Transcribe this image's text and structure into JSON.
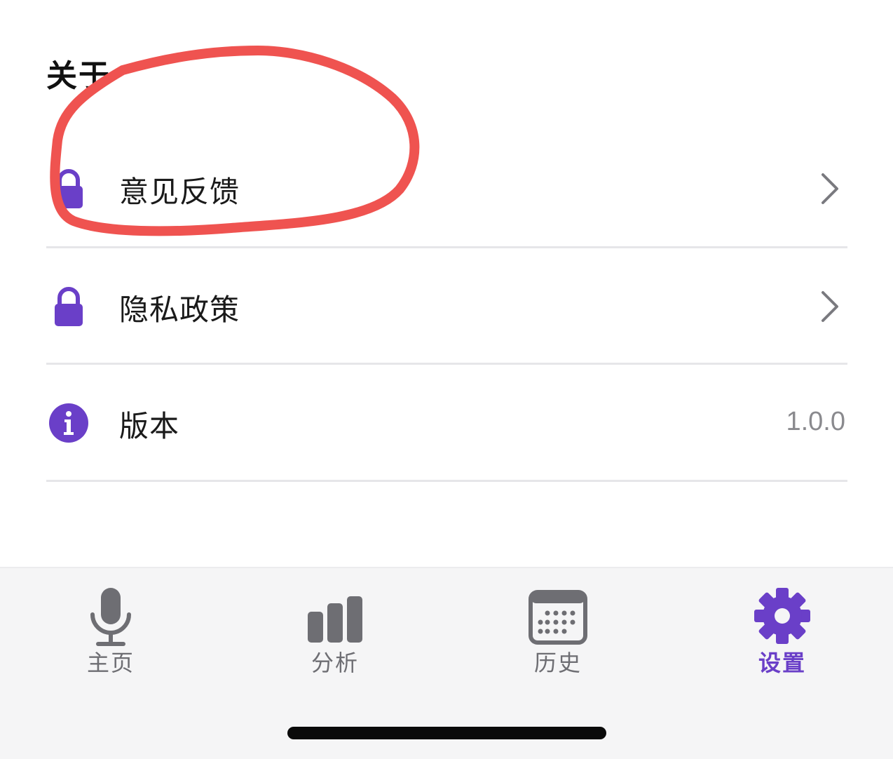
{
  "section": {
    "title": "关于"
  },
  "rows": [
    {
      "label": "意见反馈",
      "icon": "lock-icon"
    },
    {
      "label": "隐私政策",
      "icon": "lock-icon"
    },
    {
      "label": "版本",
      "icon": "info-icon",
      "value": "1.0.0"
    }
  ],
  "tabs": [
    {
      "label": "主页",
      "icon": "microphone-icon"
    },
    {
      "label": "分析",
      "icon": "bar-chart-icon"
    },
    {
      "label": "历史",
      "icon": "calendar-icon"
    },
    {
      "label": "设置",
      "icon": "gear-icon",
      "active": true
    }
  ],
  "colors": {
    "accent": "#6a3fc8",
    "annotation": "#ef5350",
    "tab_inactive": "#6e6e73"
  }
}
